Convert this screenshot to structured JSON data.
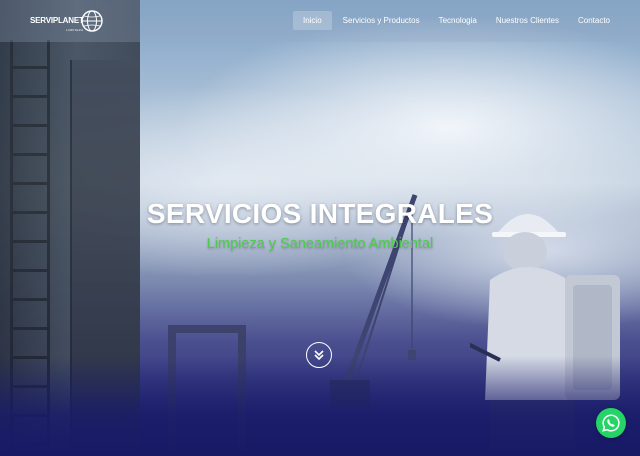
{
  "brand": {
    "logo_text": "SERVIPLANET",
    "logo_subtext": "LIMPIEZA"
  },
  "nav": {
    "items": [
      {
        "label": "Inicio",
        "active": true
      },
      {
        "label": "Servicios y Productos",
        "active": false
      },
      {
        "label": "Tecnologia",
        "active": false
      },
      {
        "label": "Nuestros Clientes",
        "active": false
      },
      {
        "label": "Contacto",
        "active": false
      }
    ]
  },
  "hero": {
    "title": "SERVICIOS INTEGRALES",
    "subtitle": "Limpieza y Saneamiento Ambiental",
    "scroll_icon": "double-chevron-down-icon"
  },
  "floating": {
    "whatsapp_icon": "whatsapp-icon"
  },
  "colors": {
    "accent_green": "#4ccc4c",
    "whatsapp_green": "#25d366",
    "overlay_navy": "#1c1e6e"
  }
}
